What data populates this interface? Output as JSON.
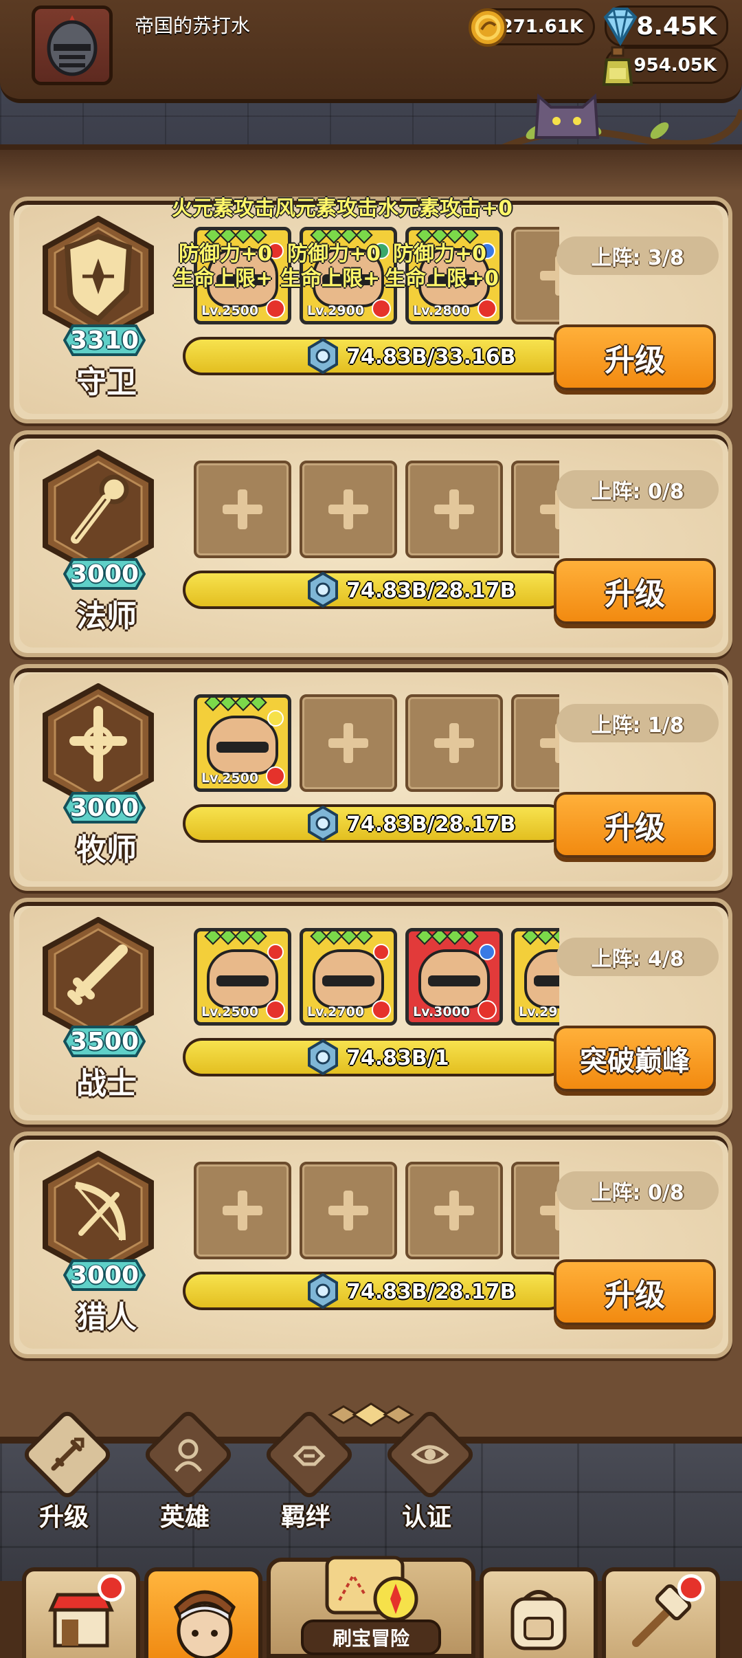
{
  "player": {
    "name": "帝国的苏打水",
    "gold": "271.61K",
    "gems": "8.45K",
    "potion": "954.05K"
  },
  "classes": [
    {
      "name": "守卫",
      "level": "3310",
      "deployed": "上阵: 3/8",
      "progress_text": "74.83B/33.16B",
      "progress": 1.0,
      "button": "升级",
      "heroes": [
        {
          "lv": "Lv.2500",
          "stars": 4,
          "color": "#f3cf3a",
          "elem": "#e5322b"
        },
        {
          "lv": "Lv.2900",
          "stars": 4,
          "color": "#f3cf3a",
          "elem": "#3aa86b"
        },
        {
          "lv": "Lv.2800",
          "stars": 4,
          "color": "#f3cf3a",
          "elem": "#3a7ae5"
        }
      ],
      "bonus": {
        "title": "火元素攻击风元素攻击水元素攻击+0",
        "def": [
          "防御力+0",
          "防御力+0",
          "防御力+0"
        ],
        "hp": [
          "生命上限+",
          "生命上限+",
          "生命上限+0"
        ]
      }
    },
    {
      "name": "法师",
      "level": "3000",
      "deployed": "上阵: 0/8",
      "progress_text": "74.83B/28.17B",
      "progress": 1.0,
      "button": "升级",
      "heroes": []
    },
    {
      "name": "牧师",
      "level": "3000",
      "deployed": "上阵: 1/8",
      "progress_text": "74.83B/28.17B",
      "progress": 1.0,
      "button": "升级",
      "heroes": [
        {
          "lv": "Lv.2500",
          "stars": 4,
          "color": "#f3cf3a",
          "elem": "#f6e14a"
        }
      ]
    },
    {
      "name": "战士",
      "level": "3500",
      "deployed": "上阵: 4/8",
      "progress_text": "74.83B/1",
      "progress": 1.0,
      "button": "突破巅峰",
      "heroes": [
        {
          "lv": "Lv.2500",
          "stars": 4,
          "color": "#f3cf3a",
          "elem": "#e5322b"
        },
        {
          "lv": "Lv.2700",
          "stars": 4,
          "color": "#f3cf3a",
          "elem": "#e5322b"
        },
        {
          "lv": "Lv.3000",
          "stars": 4,
          "color": "#e23a3a",
          "elem": "#3a7ae5"
        },
        {
          "lv": "Lv.29",
          "stars": 4,
          "color": "#f3cf3a",
          "elem": "#3aa86b"
        }
      ]
    },
    {
      "name": "猎人",
      "level": "3000",
      "deployed": "上阵: 0/8",
      "progress_text": "74.83B/28.17B",
      "progress": 1.0,
      "button": "升级",
      "heroes": []
    }
  ],
  "sub_tabs": [
    {
      "label": "升级",
      "icon": "sword-up-icon",
      "active": true
    },
    {
      "label": "英雄",
      "icon": "hero-bust-icon",
      "active": false
    },
    {
      "label": "羁绊",
      "icon": "handshake-icon",
      "active": false
    },
    {
      "label": "认证",
      "icon": "eye-icon",
      "active": false
    }
  ],
  "bottom_nav": {
    "shop": {
      "icon": "shop-icon",
      "badge": true
    },
    "hero": {
      "icon": "hero-portrait-icon",
      "active": true
    },
    "adventure": {
      "label": "刷宝冒险",
      "icon": "map-compass-icon"
    },
    "bag": {
      "icon": "backpack-icon"
    },
    "forge": {
      "icon": "hammer-icon",
      "badge": true
    }
  }
}
